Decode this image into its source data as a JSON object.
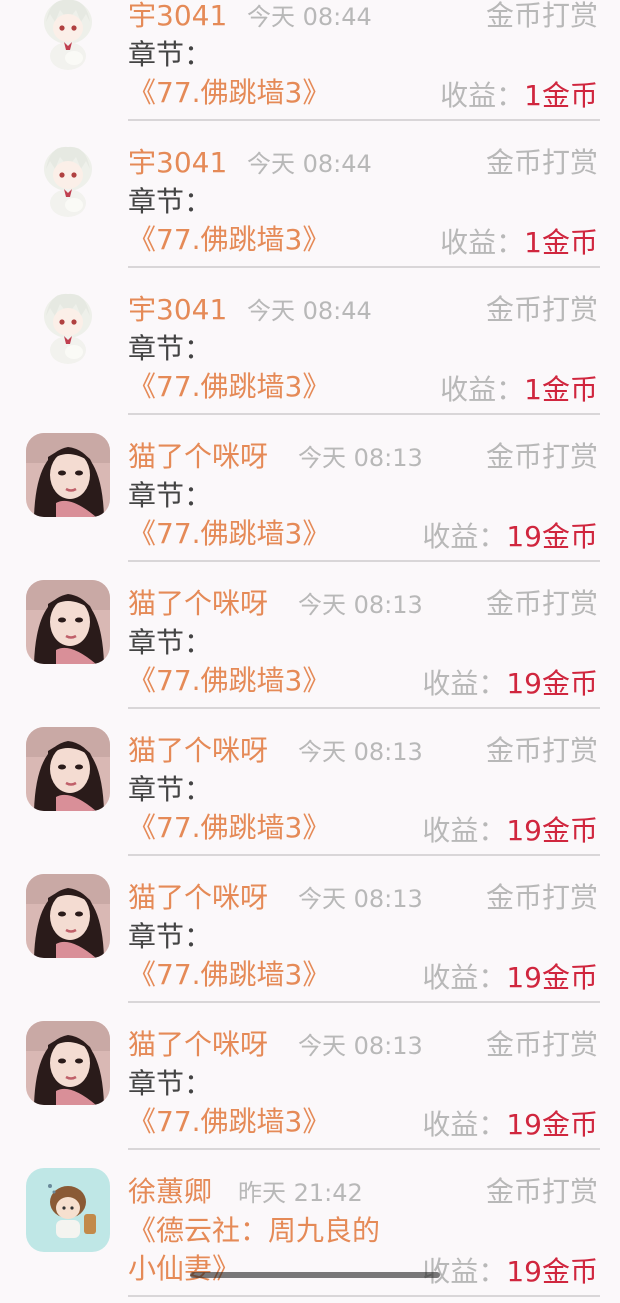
{
  "chapter_label": "章节：",
  "income_label": "收益：",
  "items": [
    {
      "name": "宇3041",
      "time": "今天 08:44",
      "type": "金币打赏",
      "chapter": "《77.佛跳墙3》",
      "amount": "1金币",
      "avatar": "anime-girl-avatar"
    },
    {
      "name": "宇3041",
      "time": "今天 08:44",
      "type": "金币打赏",
      "chapter": "《77.佛跳墙3》",
      "amount": "1金币",
      "avatar": "anime-girl-avatar"
    },
    {
      "name": "宇3041",
      "time": "今天 08:44",
      "type": "金币打赏",
      "chapter": "《77.佛跳墙3》",
      "amount": "1金币",
      "avatar": "anime-girl-avatar"
    },
    {
      "name": "猫了个咪呀",
      "time": "今天 08:13",
      "type": "金币打赏",
      "chapter": "《77.佛跳墙3》",
      "amount": "19金币",
      "avatar": "woman-photo-avatar"
    },
    {
      "name": "猫了个咪呀",
      "time": "今天 08:13",
      "type": "金币打赏",
      "chapter": "《77.佛跳墙3》",
      "amount": "19金币",
      "avatar": "woman-photo-avatar"
    },
    {
      "name": "猫了个咪呀",
      "time": "今天 08:13",
      "type": "金币打赏",
      "chapter": "《77.佛跳墙3》",
      "amount": "19金币",
      "avatar": "woman-photo-avatar"
    },
    {
      "name": "猫了个咪呀",
      "time": "今天 08:13",
      "type": "金币打赏",
      "chapter": "《77.佛跳墙3》",
      "amount": "19金币",
      "avatar": "woman-photo-avatar"
    },
    {
      "name": "猫了个咪呀",
      "time": "今天 08:13",
      "type": "金币打赏",
      "chapter": "《77.佛跳墙3》",
      "amount": "19金币",
      "avatar": "woman-photo-avatar"
    },
    {
      "name": "徐蕙卿",
      "time": "昨天 21:42",
      "type": "金币打赏",
      "chapter": "《德云社：周九良的小仙妻》",
      "amount": "19金币",
      "avatar": "cartoon-girl-avatar"
    }
  ],
  "colors": {
    "name": "#e58a57",
    "muted": "#b8b8b8",
    "amount": "#d0263e",
    "label": "#444444",
    "background": "#fbf8fa"
  }
}
